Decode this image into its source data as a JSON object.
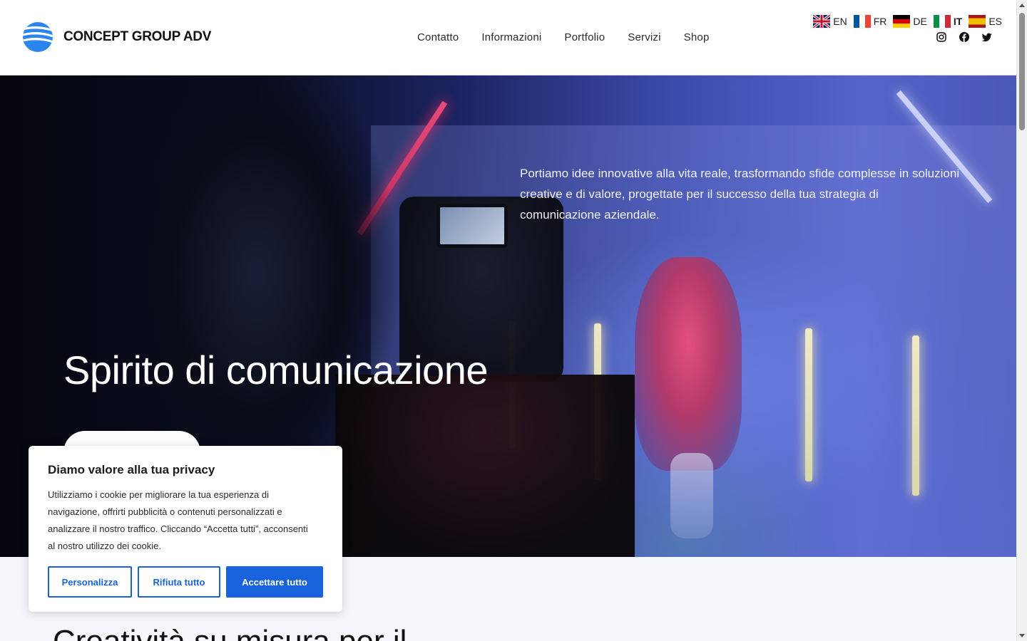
{
  "header": {
    "brand": "CONCEPT GROUP ADV",
    "nav": [
      "Contatto",
      "Informazioni",
      "Portfolio",
      "Servizi",
      "Shop"
    ],
    "languages": [
      {
        "code": "EN",
        "flag": "uk-flag-icon",
        "active": false
      },
      {
        "code": "FR",
        "flag": "france-flag-icon",
        "active": false
      },
      {
        "code": "DE",
        "flag": "germany-flag-icon",
        "active": false
      },
      {
        "code": "IT",
        "flag": "italy-flag-icon",
        "active": true
      },
      {
        "code": "ES",
        "flag": "spain-flag-icon",
        "active": false
      }
    ],
    "social": [
      "instagram-icon",
      "facebook-icon",
      "twitter-icon"
    ]
  },
  "hero": {
    "description": "Portiamo idee innovative alla vita reale, trasformando sfide complesse in soluzioni creative e di valore, progettate per il successo della tua strategia di comunicazione aziendale.",
    "title": "Spirito di comunicazione"
  },
  "section2": {
    "heading": "Creatività su misura per il"
  },
  "cookie": {
    "title": "Diamo valore alla tua privacy",
    "text": "Utilizziamo i cookie per migliorare la tua esperienza di navigazione, offrirti pubblicità o contenuti personalizzati e analizzare il nostro traffico. Cliccando “Accetta tutti”, acconsenti al nostro utilizzo dei cookie.",
    "customize": "Personalizza",
    "reject": "Rifiuta tutto",
    "accept": "Accettare tutto"
  },
  "colors": {
    "accent": "#1863dc",
    "brand_blue": "#1f7ae8"
  }
}
